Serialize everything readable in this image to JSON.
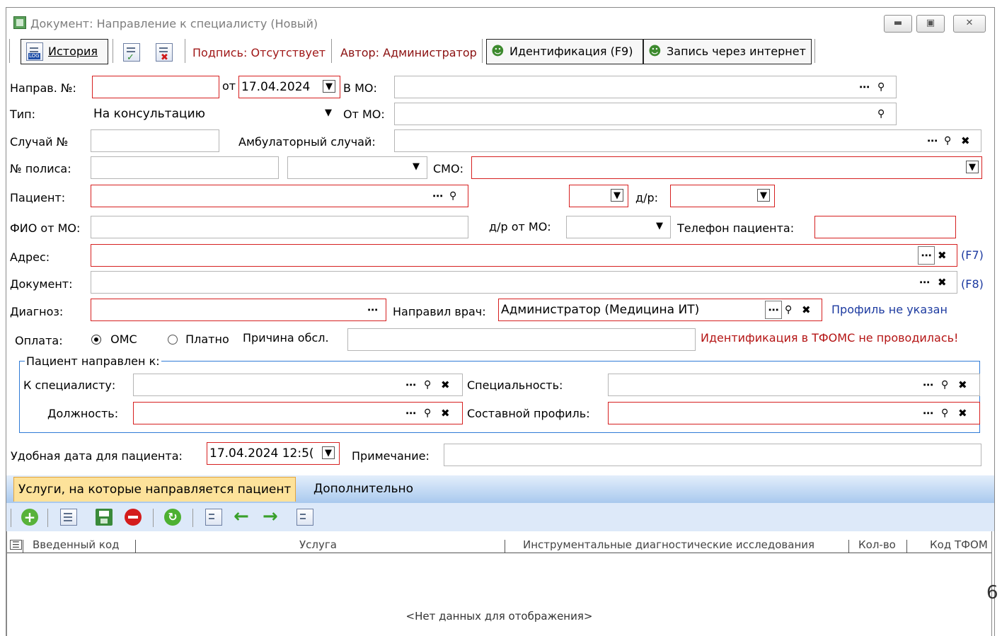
{
  "window": {
    "title": "Документ: Направление к специалисту (Новый)",
    "controls": [
      "minimize",
      "maximize",
      "close"
    ]
  },
  "toolbar": {
    "history_label": "История",
    "signature_text": "Подпись: Отсутствует",
    "author_text": "Автор: Администратор",
    "identification_label": "Идентификация  (F9)",
    "online_label": "Запись через интернет"
  },
  "form": {
    "napr_no_label": "Направ. №:",
    "napr_no_value": "",
    "ot_label": "от",
    "ot_date": "17.04.2024",
    "v_mo_label": "В МО:",
    "type_label": "Тип:",
    "type_value": "На консультацию",
    "ot_mo_label": "От МО:",
    "case_label": "Случай №",
    "amb_label": "Амбулаторный случай:",
    "policy_label": "№ полиса:",
    "smo_label": "СМО:",
    "patient_label": "Пациент:",
    "dr_label": "д/р:",
    "fio_label": "ФИО от МО:",
    "dr_mo_label": "д/р от МО:",
    "phone_label": "Телефон пациента:",
    "address_label": "Адрес:",
    "address_hotkey": "(F7)",
    "document_label": "Документ:",
    "document_hotkey": "(F8)",
    "diagnosis_label": "Диагноз:",
    "doctor_label": "Направил врач:",
    "doctor_value": "Администратор (Медицина ИТ)",
    "profile_link": "Профиль не указан",
    "payment_label": "Оплата:",
    "payment_oms": "ОМС",
    "payment_paid": "Платно",
    "reason_label": "Причина обсл.",
    "tfoms_warning": "Идентификация в ТФОМС не проводилась!",
    "group_title": "Пациент направлен к:",
    "specialist_label": "К специалисту:",
    "speciality_label": "Специальность:",
    "position_label": "Должность:",
    "composite_label": "Составной профиль:",
    "convenient_label": "Удобная дата для пациента:",
    "convenient_value": "17.04.2024 12:5(",
    "note_label": "Примечание:"
  },
  "tabs": [
    {
      "label": "Услуги, на которые направляется пациент",
      "active": true
    },
    {
      "label": "Дополнительно",
      "active": false
    }
  ],
  "grid": {
    "columns": [
      "Введенный код",
      "Услуга",
      "Инструментальные диагностические исследования",
      "Кол-во",
      "Код ТФОМ"
    ],
    "empty_text": "<Нет данных для отображения>"
  },
  "page_marker": "6",
  "colors": {
    "required_border": "#d62020",
    "link": "#1c3aa0",
    "warning": "#b41414",
    "group_border": "#2f7bd6",
    "active_tab": "#fde29a"
  }
}
